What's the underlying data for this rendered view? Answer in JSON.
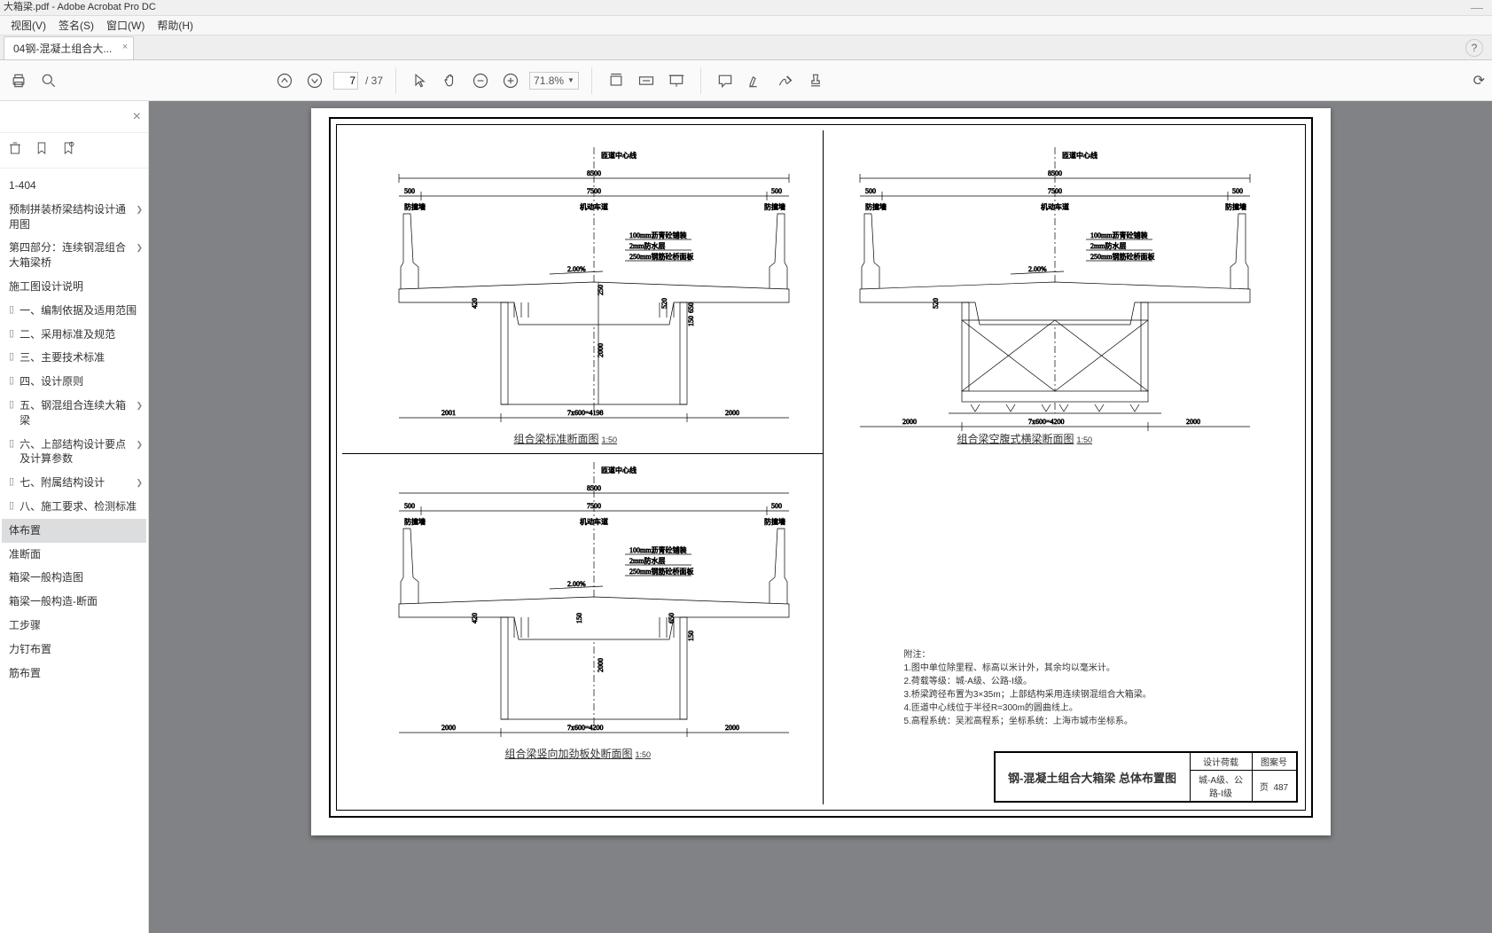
{
  "titlebar": {
    "text": "大箱梁.pdf - Adobe Acrobat Pro DC",
    "dash": "—"
  },
  "menubar": [
    "视图(V)",
    "签名(S)",
    "窗口(W)",
    "帮助(H)"
  ],
  "tab": {
    "label": "04钢-混凝土组合大...",
    "close": "×",
    "help": "?"
  },
  "toolbar": {
    "page_current": "7",
    "page_total": "/ 37",
    "zoom": "71.8%"
  },
  "sidebar": {
    "close": "×",
    "head_item": "1-404",
    "items": [
      {
        "text": "预制拼装桥梁结构设计通用图",
        "arrow": true
      },
      {
        "text": "第四部分：连续钢混组合大箱梁桥",
        "arrow": true
      },
      {
        "text": "施工图设计说明",
        "arrow": ""
      },
      {
        "text": "一、编制依据及适用范围",
        "icon": true
      },
      {
        "text": "二、采用标准及规范",
        "icon": true
      },
      {
        "text": "三、主要技术标准",
        "icon": true
      },
      {
        "text": "四、设计原则",
        "icon": true
      },
      {
        "text": "五、钢混组合连续大箱梁",
        "icon": true,
        "arrow": true
      },
      {
        "text": "六、上部结构设计要点及计算参数",
        "icon": true,
        "arrow": true
      },
      {
        "text": "七、附属结构设计",
        "icon": true,
        "arrow": true
      },
      {
        "text": "八、施工要求、检测标准",
        "icon": true
      },
      {
        "text": "体布置",
        "active": true
      },
      {
        "text": "准断面"
      },
      {
        "text": "箱梁一般构造图"
      },
      {
        "text": "箱梁一般构造-断面"
      },
      {
        "text": "工步骤"
      },
      {
        "text": "力钉布置"
      },
      {
        "text": "筋布置"
      }
    ]
  },
  "drawing": {
    "sections": [
      {
        "title": "组合梁标准断面图",
        "scale": "1:50"
      },
      {
        "title": "组合梁空腹式横梁断面图",
        "scale": "1:50"
      },
      {
        "title": "组合梁竖向加劲板处断面图",
        "scale": "1:50"
      }
    ],
    "center_label": "匝道中心线",
    "road_label": "机动车道",
    "barrier_label": "防撞墙",
    "layers": {
      "l1": "100mm沥青砼铺装",
      "l2": "2mm防水层",
      "l3": "250mm钢筋砼桥面板"
    },
    "slope": "2.00%",
    "dims": {
      "overall": "8500",
      "main": "7500",
      "side": "500",
      "bottom_left": "2001",
      "bottom_mid": "7x600=4198",
      "bottom_right": "2000",
      "bottom_left2": "2000",
      "bottom_mid2": "7x600=4200",
      "h_top": "250",
      "h_main": "650",
      "h_btm": "150",
      "col_h": "2000",
      "sm": "520",
      "sm2": "420"
    },
    "notes_title": "附注：",
    "notes": [
      "1.图中单位除里程、标高以米计外，其余均以毫米计。",
      "2.荷载等级：城-A级、公路-I级。",
      "3.桥梁跨径布置为3×35m；上部结构采用连续钢混组合大箱梁。",
      "4.匝道中心线位于半径R=300m的圆曲线上。",
      "5.高程系统：吴淞高程系；坐标系统：上海市城市坐标系。"
    ],
    "title_block": {
      "main": "钢-混凝土组合大箱梁  总体布置图",
      "r1c1": "设计荷载",
      "r1c2": "图案号",
      "r2c1": "城-A级、公路-I级",
      "r2c2": "页",
      "r2c3": "487"
    }
  }
}
